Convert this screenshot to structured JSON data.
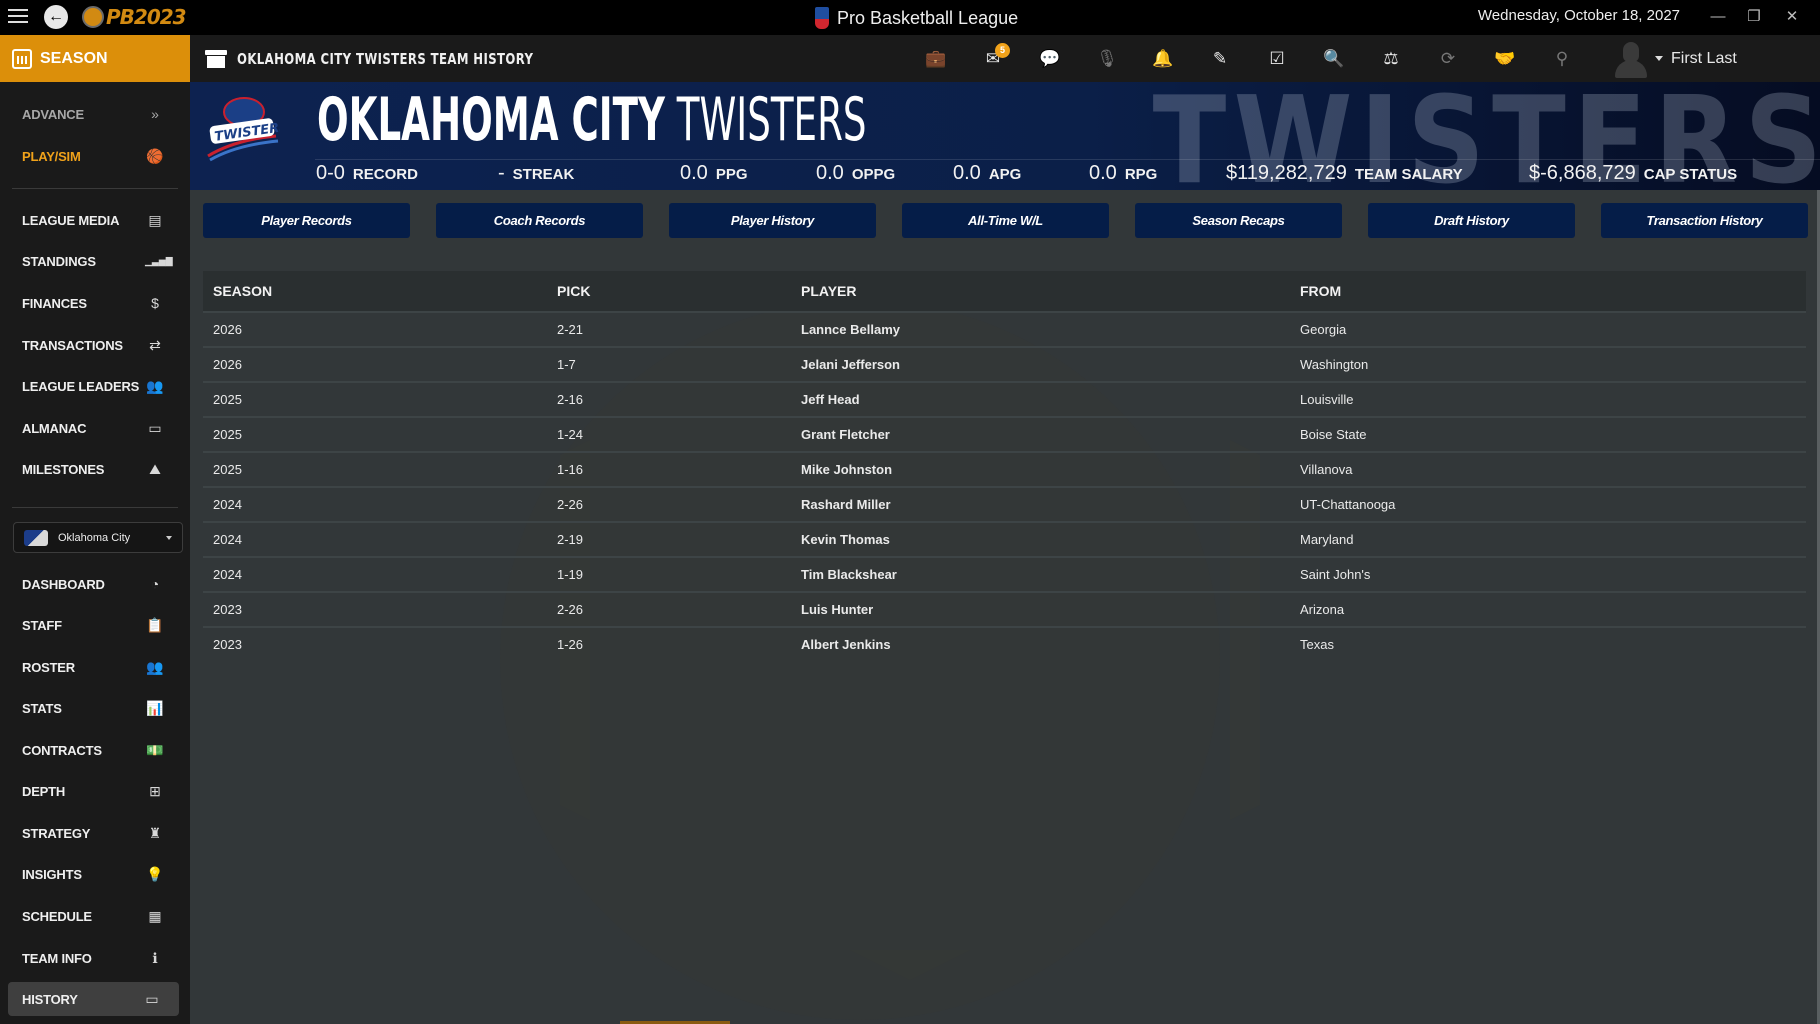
{
  "window": {
    "app_title": "Pro Basketball League",
    "logo_text": "PB2023",
    "date": "Wednesday, October 18, 2027",
    "controls": {
      "minimize": "—",
      "restore": "❐",
      "close": "✕"
    }
  },
  "header": {
    "section_label": "SEASON",
    "page_title": "OKLAHOMA CITY TWISTERS TEAM HISTORY",
    "mail_badge": "5",
    "icons": [
      "briefcase-icon",
      "mail-icon",
      "chat-icon",
      "microphone-icon",
      "bell-icon",
      "edit-icon",
      "calendar-check-icon",
      "search-icon",
      "scale-icon",
      "sync-icon",
      "handshake-icon",
      "binoculars-icon"
    ],
    "user_name": "First Last"
  },
  "sidebar": {
    "top_items": [
      {
        "label": "ADVANCE",
        "icon": "»"
      },
      {
        "label": "PLAY/SIM",
        "icon": "🏀"
      }
    ],
    "league_items": [
      {
        "label": "LEAGUE MEDIA",
        "icon": "▤"
      },
      {
        "label": "STANDINGS",
        "icon": "▁▃▅▇"
      },
      {
        "label": "FINANCES",
        "icon": "$"
      },
      {
        "label": "TRANSACTIONS",
        "icon": "⇄"
      },
      {
        "label": "LEAGUE LEADERS",
        "icon": "👥"
      },
      {
        "label": "ALMANAC",
        "icon": "▭"
      },
      {
        "label": "MILESTONES",
        "icon": "⛰"
      }
    ],
    "team_select": {
      "value": "Oklahoma City"
    },
    "team_items": [
      {
        "label": "DASHBOARD",
        "icon": "◔"
      },
      {
        "label": "STAFF",
        "icon": "📋"
      },
      {
        "label": "ROSTER",
        "icon": "👥"
      },
      {
        "label": "STATS",
        "icon": "📊"
      },
      {
        "label": "CONTRACTS",
        "icon": "💵"
      },
      {
        "label": "DEPTH",
        "icon": "⊞"
      },
      {
        "label": "STRATEGY",
        "icon": "♜"
      },
      {
        "label": "INSIGHTS",
        "icon": "💡"
      },
      {
        "label": "SCHEDULE",
        "icon": "▦"
      },
      {
        "label": "TEAM INFO",
        "icon": "ℹ"
      },
      {
        "label": "HISTORY",
        "icon": "▭"
      }
    ]
  },
  "banner": {
    "team_city": "OKLAHOMA CITY",
    "team_nickname": "TWISTERS",
    "watermark": "TWISTERS",
    "stats": [
      {
        "value": "0-0",
        "label": "RECORD"
      },
      {
        "value": "-",
        "label": "STREAK"
      },
      {
        "value": "0.0",
        "label": "PPG"
      },
      {
        "value": "0.0",
        "label": "OPPG"
      },
      {
        "value": "0.0",
        "label": "APG"
      },
      {
        "value": "0.0",
        "label": "RPG"
      },
      {
        "value": "$119,282,729",
        "label": "TEAM SALARY"
      },
      {
        "value": "$-6,868,729",
        "label": "CAP STATUS"
      }
    ]
  },
  "tabs": [
    "Player Records",
    "Coach Records",
    "Player History",
    "All-Time W/L",
    "Season Recaps",
    "Draft History",
    "Transaction History"
  ],
  "table": {
    "columns": [
      "SEASON",
      "PICK",
      "PLAYER",
      "FROM"
    ],
    "rows": [
      [
        "2026",
        "2-21",
        "Lannce Bellamy",
        "Georgia"
      ],
      [
        "2026",
        "1-7",
        "Jelani Jefferson",
        "Washington"
      ],
      [
        "2025",
        "2-16",
        "Jeff Head",
        "Louisville"
      ],
      [
        "2025",
        "1-24",
        "Grant Fletcher",
        "Boise State"
      ],
      [
        "2025",
        "1-16",
        "Mike Johnston",
        "Villanova"
      ],
      [
        "2024",
        "2-26",
        "Rashard Miller",
        "UT-Chattanooga"
      ],
      [
        "2024",
        "2-19",
        "Kevin Thomas",
        "Maryland"
      ],
      [
        "2024",
        "1-19",
        "Tim Blackshear",
        "Saint John's"
      ],
      [
        "2023",
        "2-26",
        "Luis Hunter",
        "Arizona"
      ],
      [
        "2023",
        "1-26",
        "Albert Jenkins",
        "Texas"
      ]
    ]
  },
  "colors": {
    "accent": "#dc8f0a",
    "banner": "#0b1f48",
    "tab_button": "#051d48",
    "sidebar": "#1a1a1a",
    "content_bg": "#323739"
  }
}
